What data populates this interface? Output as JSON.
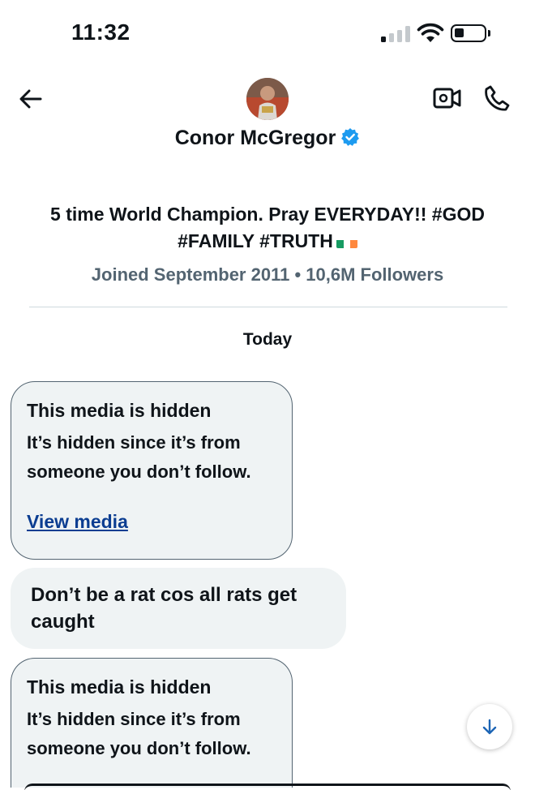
{
  "status_bar": {
    "time": "11:32"
  },
  "header": {
    "back_icon": "arrow-left-icon",
    "video_icon": "video-call-icon",
    "phone_icon": "phone-icon",
    "name": "Conor McGregor",
    "verified_icon": "verified-badge-icon",
    "accent_color": "#1d9bf0"
  },
  "profile": {
    "bio": "5 time World Champion. Pray EVERYDAY!! #GOD #FAMILY #TRUTH",
    "flag_icon": "ireland-flag-icon",
    "meta": "Joined September 2011 • 10,6M Followers"
  },
  "conversation": {
    "day_label": "Today",
    "messages": [
      {
        "type": "hidden-media",
        "title": "This media is hidden",
        "description": "It’s hidden since it’s from someone you don’t follow.",
        "link": "View media"
      },
      {
        "type": "text",
        "text": "Don’t be a rat cos all rats get caught"
      },
      {
        "type": "hidden-media",
        "title": "This media is hidden",
        "description": "It’s hidden since it’s from someone you don’t follow."
      }
    ]
  },
  "scroll_button_icon": "arrow-down-icon"
}
